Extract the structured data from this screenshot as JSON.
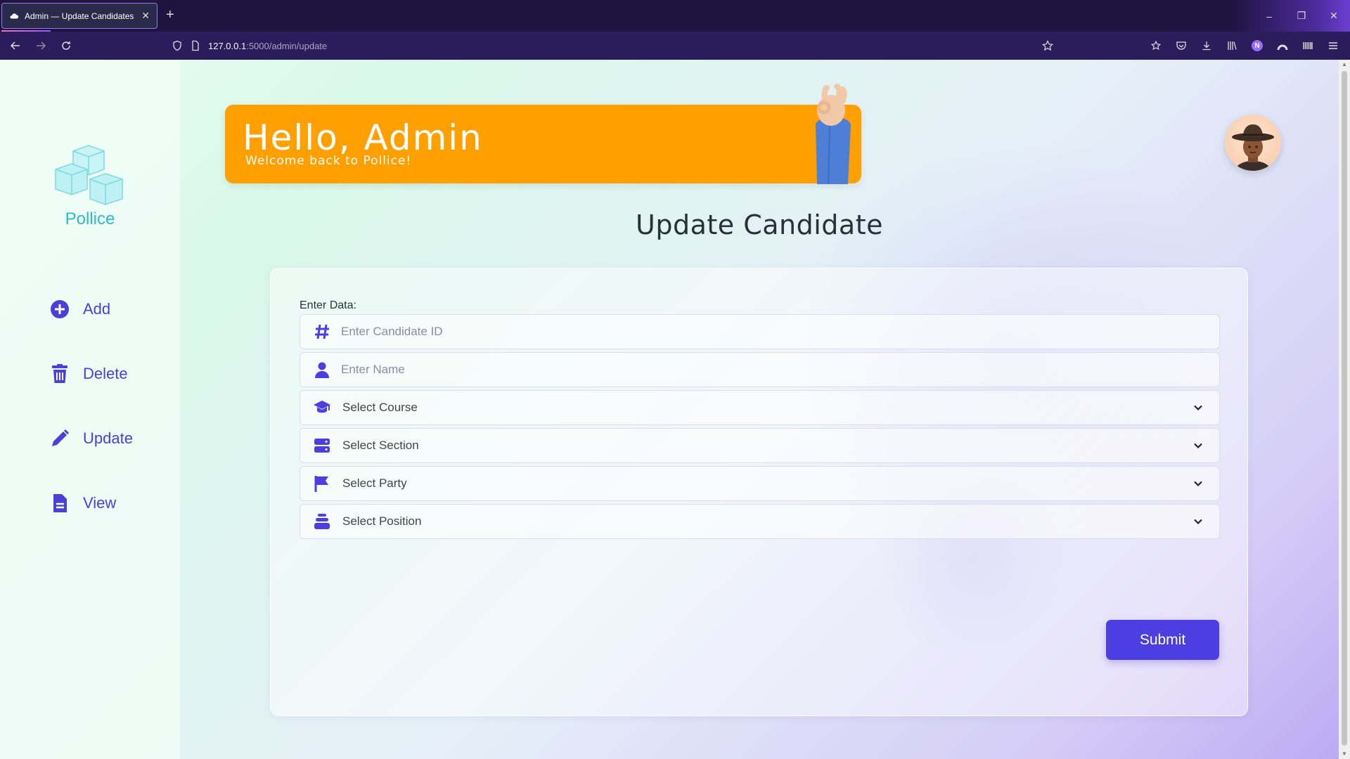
{
  "browser": {
    "tab_title": "Admin — Update Candidates",
    "tab_close": "✕",
    "new_tab": "+",
    "url_host": "127.0.0.1",
    "url_path": ":5000/admin/update",
    "window_buttons": {
      "minimize": "–",
      "restore": "❐",
      "close": "✕"
    }
  },
  "sidebar": {
    "brand": "Pollice",
    "items": [
      {
        "label": "Add",
        "icon": "plus-circle-icon"
      },
      {
        "label": "Delete",
        "icon": "trash-icon"
      },
      {
        "label": "Update",
        "icon": "pencil-icon"
      },
      {
        "label": "View",
        "icon": "document-icon"
      }
    ]
  },
  "banner": {
    "title": "Hello, Admin",
    "subtitle": "Welcome back to Pollice!"
  },
  "main": {
    "title": "Update Candidate",
    "form_label": "Enter Data:",
    "fields": {
      "candidate_id": {
        "placeholder": "Enter Candidate ID",
        "icon": "hash-icon"
      },
      "name": {
        "placeholder": "Enter Name",
        "icon": "user-icon"
      },
      "course": {
        "value": "Select Course",
        "icon": "graduation-cap-icon"
      },
      "section": {
        "value": "Select Section",
        "icon": "server-icon"
      },
      "party": {
        "value": "Select Party",
        "icon": "flag-icon"
      },
      "position": {
        "value": "Select Position",
        "icon": "layer-stack-icon"
      }
    },
    "submit_label": "Submit"
  },
  "colors": {
    "accent": "#4b3fe1",
    "banner": "#ff9f00",
    "brand": "#2dbcc4",
    "browser_chrome": "#1f1440"
  }
}
